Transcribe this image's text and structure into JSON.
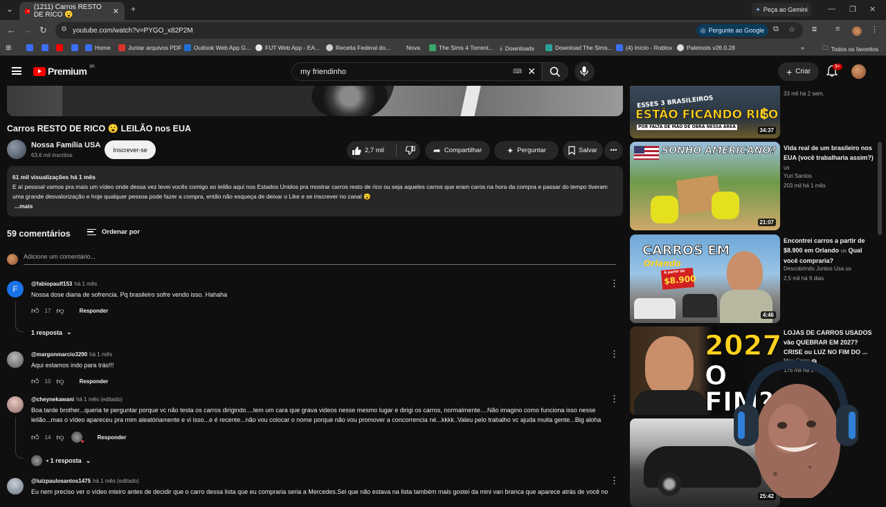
{
  "browser": {
    "tab_title": "(1211) Carros RESTO DE RICO 😮",
    "gemini_label": "Peça ao Gemini",
    "url": "youtube.com/watch?v=PYGO_x82P2M",
    "ask_google": "Pergunte ao Google",
    "bookmarks": [
      {
        "label": "Home",
        "color": "#3b6ff5"
      },
      {
        "label": "Juntar arquivos PDF",
        "color": "#d9342b"
      },
      {
        "label": "Outlook Web App G...",
        "color": "#1f6fd1"
      },
      {
        "label": "FUT Web App - EA...",
        "color": "#e5e5e5"
      },
      {
        "label": "Receita Federal do...",
        "color": "#cfcfcf"
      },
      {
        "label": "Nova",
        "color": "#777777"
      },
      {
        "label": "The Sims 4 Torrent...",
        "color": "#3aa66a"
      },
      {
        "label": "Downloads",
        "color": "#cccccc"
      },
      {
        "label": "Download The Sims...",
        "color": "#2aa198"
      },
      {
        "label": "(4) Início - Roblox",
        "color": "#3b6ff5"
      },
      {
        "label": "Paletools v26.0.28",
        "color": "#dddddd"
      }
    ],
    "all_favorites": "Todos os favoritos"
  },
  "youtube": {
    "logo": "Premium",
    "region": "BR",
    "search_query": "my friendinho",
    "create_label": "Criar",
    "notifications": "9+"
  },
  "video": {
    "title": "Carros RESTO DE RICO 😮 LEILÃO nos EUA",
    "channel": "Nossa Família USA",
    "subscribers": "63,6 mil inscritos",
    "subscribe_label": "Inscrever-se",
    "likes": "2,7 mil",
    "share_label": "Compartilhar",
    "ask_label": "Perguntar",
    "save_label": "Salvar",
    "views_date": "61 mil visualizações  há 1 mês",
    "description": "E aí pessoal vamos pra mais um vídeo onde dessa vez levei vocês comigo ao leilão aqui nos Estados Unidos pra mostrar carros resto de rico ou seja aqueles carros que eram caros na hora da compra e passar do tempo tiveram uma grande desvalorização e hoje qualquer pessoa pode fazer a compra, então não esqueça de deixar o Like e se inscrever no canal 😮",
    "more_label": "...mais"
  },
  "comments": {
    "count_label": "59 comentários",
    "sort_label": "Ordenar por",
    "add_placeholder": "Adicione um comentário...",
    "reply_label": "Responder",
    "items": [
      {
        "author": "@fabiopaulf153",
        "time": "há 1 mês",
        "text": "Nossa dose diaria de sofrencia. Pq brasileiro sofre vendo isso. Hahaha",
        "likes": "17",
        "replies": "1 resposta"
      },
      {
        "author": "@margonmarcio3290",
        "time": "há 1 mês",
        "text": "Aqui estamos indo para trás!!!",
        "likes": "10",
        "replies": ""
      },
      {
        "author": "@cheynekawani",
        "time": "há 1 mês (editado)",
        "text": "Boa tarde brother...queria te perguntar porque vc não testa os carros dirigindo....tem um cara que grava videos nesse mesmo lugar e dirigi os carros, normalmente....Não imagino como funciona isso nesse leilão...mas o vídeo apareceu pra mim  aleatóriamente e vi isso...e é recente...não vou colocar o nome porque não vou promover a concorrencia né...kkkk..Valeu pelo trabalho vc ajuda muita gente...Big aloha",
        "likes": "14",
        "replies": "• 1 resposta"
      },
      {
        "author": "@luizpaulosantos1475",
        "time": "há 1 mês (editado)",
        "text": "Eu nem preciso ver o vídeo inteiro antes de decidir que o carro dessa lista que eu compraria seria a Mercedes.Sei que não estava na lista também mais gostei da mini van branca que aparece atrás de você no",
        "likes": "",
        "replies": ""
      }
    ]
  },
  "sidebar": {
    "items": [
      {
        "title": "",
        "channel": "",
        "meta": "33 mil  há 2 sem.",
        "duration": "34:37",
        "thumb_line1": "ESSES 3 BRASILEIROS",
        "thumb_line2": "ESTÃO FICANDO RICO",
        "thumb_line3": "POR FALTA DE MÃO DE OBRA NESSA ÁREA"
      },
      {
        "title": "Vida real de um brasileiro nos EUA (você trabalharia assim?)",
        "badge": "us",
        "channel": "Yuri Santos",
        "meta": "203 mil  há 1 mês",
        "duration": "21:07",
        "thumb_line1": "SONHO AMERICANO?"
      },
      {
        "title": "Encontrei carros a partir de $8.900 em Orlando",
        "badge": "us",
        "title_tail": "Qual você compraria?",
        "channel": "Descobrindo Juntos Usa",
        "channel_badge": "us",
        "meta": "2,5 mil  há 9 dias",
        "duration": "4:46",
        "thumb_line1": "CARROS EM",
        "thumb_line2": "Orlando",
        "thumb_line3": "A partir de",
        "thumb_line4": "$8.900"
      },
      {
        "title": "LOJAS DE CARROS USADOS vão QUEBRAR EM 2027? CRISE ou LUZ NO FIM DO ...",
        "channel": "Meu Carro",
        "meta": "176 mil  há 3",
        "duration": "",
        "thumb_line1": "2027:",
        "thumb_line2": "O FIM?"
      },
      {
        "title": "",
        "channel": "",
        "meta": "",
        "duration": "25:42"
      }
    ]
  }
}
